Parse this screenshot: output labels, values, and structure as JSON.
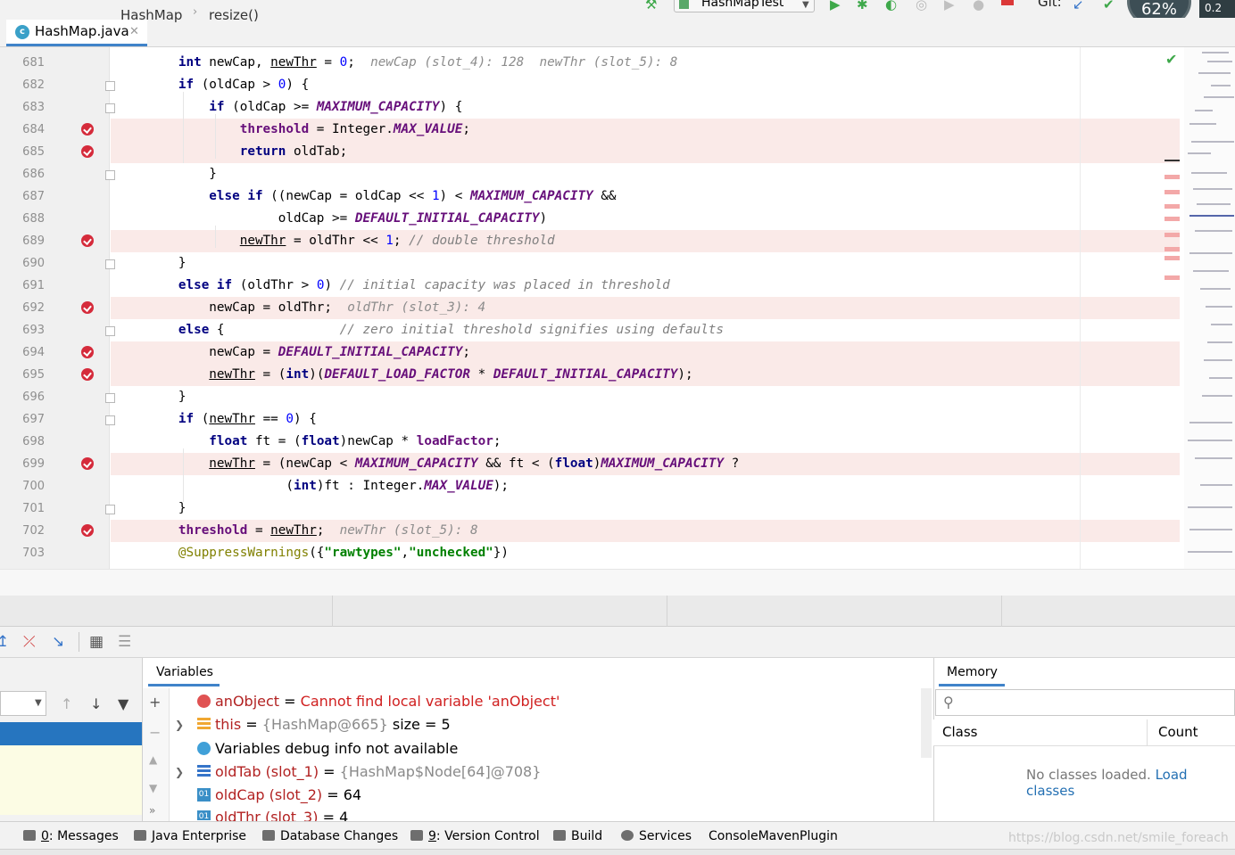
{
  "toolbar": {
    "run_config": "HashMapTest",
    "git_label": "Git:",
    "memory_gauge": "62%",
    "memory_text": "0.2"
  },
  "editor": {
    "file_tab": "HashMap.java",
    "lines": [
      "681",
      "682",
      "683",
      "684",
      "685",
      "686",
      "687",
      "688",
      "689",
      "690",
      "691",
      "692",
      "693",
      "694",
      "695",
      "696",
      "697",
      "698",
      "699",
      "700",
      "701",
      "702",
      "703"
    ]
  },
  "breadcrumb": {
    "class": "HashMap",
    "method": "resize()"
  },
  "debugger": {
    "variables_tab": "Variables",
    "memory_tab": "Memory",
    "variables": [
      {
        "name": "anObject",
        "eq": " = ",
        "value": "Cannot find local variable 'anObject'"
      },
      {
        "name": "this",
        "eq": " = ",
        "value": "{HashMap@665}",
        "extra": "size = 5"
      },
      {
        "text": "Variables debug info not available"
      },
      {
        "name": "oldTab (slot_1)",
        "eq": " = ",
        "value": "{HashMap$Node[64]@708}"
      },
      {
        "name": "oldCap (slot_2)",
        "eq": " = ",
        "value": "64"
      },
      {
        "name": "oldThr (slot_3)",
        "eq": " = ",
        "value": "4"
      }
    ],
    "memory": {
      "col_class": "Class",
      "col_count": "Count",
      "empty_text": "No classes loaded.",
      "load_link": "Load classes"
    }
  },
  "bottom_tabs": [
    {
      "num": "0",
      "label": ": Messages"
    },
    {
      "label": "Java Enterprise"
    },
    {
      "label": "Database Changes"
    },
    {
      "num": "9",
      "label": ": Version Control"
    },
    {
      "label": "Build"
    },
    {
      "label": "Services"
    },
    {
      "label": "ConsoleMavenPlugin"
    }
  ],
  "watermark": "https://blog.csdn.net/smile_foreach",
  "colors": {
    "accent": "#4083c9",
    "breakpoint": "#d52b3b",
    "highlight": "#faeae8",
    "selection": "#2675bf"
  }
}
